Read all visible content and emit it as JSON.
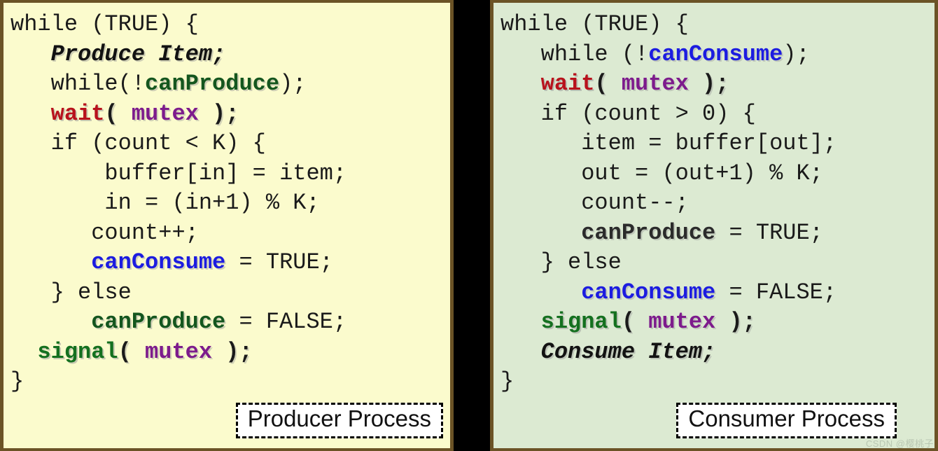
{
  "colors": {
    "background": "#000000",
    "producer_bg": "#fbfbcd",
    "consumer_bg": "#dcead2",
    "panel_border": "#6b5326",
    "keyword_green": "#14561e",
    "keyword_blue": "#1c1ce0",
    "wait_red": "#b8121c",
    "mutex_purple": "#7d1b8c",
    "signal_green": "#14701f",
    "plain_text": "#1a1a1a",
    "caption_bg": "#ffffff",
    "caption_border": "#000000"
  },
  "producer": {
    "caption": "Producer Process",
    "lines": [
      [
        {
          "t": "while (TRUE) {",
          "c": "tok-plain"
        }
      ],
      [
        {
          "t": "   ",
          "c": "tok-plain"
        },
        {
          "t": "Produce Item;",
          "c": "tok-bolditalic"
        }
      ],
      [
        {
          "t": "   while(!",
          "c": "tok-plain"
        },
        {
          "t": "canProduce",
          "c": "tok-green"
        },
        {
          "t": ");",
          "c": "tok-plain"
        }
      ],
      [
        {
          "t": "   ",
          "c": "tok-plain"
        },
        {
          "t": "wait",
          "c": "tok-red"
        },
        {
          "t": "( ",
          "c": "tok-boldplain"
        },
        {
          "t": "mutex",
          "c": "tok-purple"
        },
        {
          "t": " );",
          "c": "tok-boldplain"
        }
      ],
      [
        {
          "t": "   if (count < K) {",
          "c": "tok-plain"
        }
      ],
      [
        {
          "t": "       buffer[in] = item;",
          "c": "tok-plain"
        }
      ],
      [
        {
          "t": "       in = (in+1) % K;",
          "c": "tok-plain"
        }
      ],
      [
        {
          "t": "      count++;",
          "c": "tok-plain"
        }
      ],
      [
        {
          "t": "      ",
          "c": "tok-plain"
        },
        {
          "t": "canConsume",
          "c": "tok-blue"
        },
        {
          "t": " = TRUE;",
          "c": "tok-plain"
        }
      ],
      [
        {
          "t": "   } else",
          "c": "tok-plain"
        }
      ],
      [
        {
          "t": "      ",
          "c": "tok-plain"
        },
        {
          "t": "canProduce",
          "c": "tok-green"
        },
        {
          "t": " = FALSE;",
          "c": "tok-plain"
        }
      ],
      [
        {
          "t": "  ",
          "c": "tok-plain"
        },
        {
          "t": "signal",
          "c": "tok-signal"
        },
        {
          "t": "( ",
          "c": "tok-boldplain"
        },
        {
          "t": "mutex",
          "c": "tok-purple"
        },
        {
          "t": " );",
          "c": "tok-boldplain"
        }
      ],
      [
        {
          "t": "}",
          "c": "tok-plain"
        }
      ]
    ]
  },
  "consumer": {
    "caption": "Consumer Process",
    "lines": [
      [
        {
          "t": "while (TRUE) {",
          "c": "tok-plain"
        }
      ],
      [
        {
          "t": "   while (!",
          "c": "tok-plain"
        },
        {
          "t": "canConsume",
          "c": "tok-blue"
        },
        {
          "t": ");",
          "c": "tok-plain"
        }
      ],
      [
        {
          "t": "   ",
          "c": "tok-plain"
        },
        {
          "t": "wait",
          "c": "tok-red"
        },
        {
          "t": "( ",
          "c": "tok-boldplain"
        },
        {
          "t": "mutex",
          "c": "tok-purple"
        },
        {
          "t": " );",
          "c": "tok-boldplain"
        }
      ],
      [
        {
          "t": "   if (count > 0) {",
          "c": "tok-plain"
        }
      ],
      [
        {
          "t": "      item = buffer[out];",
          "c": "tok-plain"
        }
      ],
      [
        {
          "t": "      out = (out+1) % K;",
          "c": "tok-plain"
        }
      ],
      [
        {
          "t": "      count--;",
          "c": "tok-plain"
        }
      ],
      [
        {
          "t": "      ",
          "c": "tok-plain"
        },
        {
          "t": "canProduce",
          "c": "tok-dark"
        },
        {
          "t": " = TRUE;",
          "c": "tok-plain"
        }
      ],
      [
        {
          "t": "   } else",
          "c": "tok-plain"
        }
      ],
      [
        {
          "t": "      ",
          "c": "tok-plain"
        },
        {
          "t": "canConsume",
          "c": "tok-blue"
        },
        {
          "t": " = FALSE;",
          "c": "tok-plain"
        }
      ],
      [
        {
          "t": "   ",
          "c": "tok-plain"
        },
        {
          "t": "signal",
          "c": "tok-signal"
        },
        {
          "t": "( ",
          "c": "tok-boldplain"
        },
        {
          "t": "mutex",
          "c": "tok-purple"
        },
        {
          "t": " );",
          "c": "tok-boldplain"
        }
      ],
      [
        {
          "t": "   ",
          "c": "tok-plain"
        },
        {
          "t": "Consume Item;",
          "c": "tok-bolditalic"
        }
      ],
      [
        {
          "t": "}",
          "c": "tok-plain"
        }
      ]
    ]
  },
  "watermark": {
    "text": "CSDN @樱桃子"
  }
}
